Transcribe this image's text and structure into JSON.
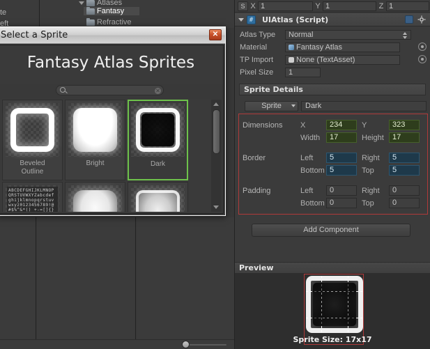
{
  "background": {
    "left_labels": [
      "te",
      "eft"
    ],
    "tree_items": [
      {
        "label": "Atlases",
        "selected": false
      },
      {
        "label": "Fantasy",
        "selected": true
      },
      {
        "label": "Refractive",
        "selected": false
      }
    ]
  },
  "dialog": {
    "title": "Select a Sprite",
    "close_label": "✕",
    "heading": "Fantasy Atlas Sprites",
    "search": {
      "value": "",
      "placeholder": ""
    },
    "sprites": [
      {
        "label": "Beveled\nOutline",
        "art": "beveled",
        "selected": false
      },
      {
        "label": "Bright",
        "art": "bright",
        "selected": false
      },
      {
        "label": "Dark",
        "art": "dark",
        "selected": true
      },
      {
        "label": "",
        "art": "font",
        "selected": false
      },
      {
        "label": "",
        "art": "softbox",
        "selected": false
      },
      {
        "label": "",
        "art": "softbox2",
        "selected": false
      }
    ],
    "font_art_text": "ABCDEFGHIJKLMNOPQRSTUVWXYZabcdefghijklmnopqrstuvwxyz0123456789!@#$%^&*()_+-=[]{}|;':\",./<>?`~"
  },
  "inspector": {
    "scale_row": {
      "badge": "S",
      "axes": [
        {
          "label": "X",
          "value": "1"
        },
        {
          "label": "Y",
          "value": "1"
        },
        {
          "label": "Z",
          "value": "1"
        }
      ]
    },
    "component": {
      "title": "UIAtlas (Script)",
      "properties": [
        {
          "label": "Atlas Type",
          "value": "Normal",
          "kind": "popup"
        },
        {
          "label": "Material",
          "value": "Fantasy Atlas",
          "kind": "object",
          "dot": "mat"
        },
        {
          "label": "TP Import",
          "value": "None (TextAsset)",
          "kind": "object",
          "dot": "txt"
        },
        {
          "label": "Pixel Size",
          "value": "1",
          "kind": "text"
        }
      ]
    },
    "sprite_details": {
      "section_title": "Sprite Details",
      "popup_button": "Sprite",
      "sprite_name": "Dark",
      "groups": [
        {
          "name": "Dimensions",
          "style": "green",
          "fields": [
            {
              "label": "X",
              "value": "234"
            },
            {
              "label": "Y",
              "value": "323"
            },
            {
              "label": "Width",
              "value": "17"
            },
            {
              "label": "Height",
              "value": "17"
            }
          ]
        },
        {
          "name": "Border",
          "style": "blue",
          "fields": [
            {
              "label": "Left",
              "value": "5"
            },
            {
              "label": "Right",
              "value": "5"
            },
            {
              "label": "Bottom",
              "value": "5"
            },
            {
              "label": "Top",
              "value": "5"
            }
          ]
        },
        {
          "name": "Padding",
          "style": "grey",
          "fields": [
            {
              "label": "Left",
              "value": "0"
            },
            {
              "label": "Right",
              "value": "0"
            },
            {
              "label": "Bottom",
              "value": "0"
            },
            {
              "label": "Top",
              "value": "0"
            }
          ]
        }
      ]
    },
    "add_component_label": "Add Component",
    "preview": {
      "title": "Preview",
      "caption": "Sprite Size: 17x17"
    }
  },
  "colors": {
    "panel_bg": "#3b3b3b",
    "field_bg": "#434343",
    "green_field": "#2e3d1c",
    "blue_field": "#1e394a",
    "highlight_red": "#b03a3a",
    "selection_green": "#6ec24b"
  }
}
